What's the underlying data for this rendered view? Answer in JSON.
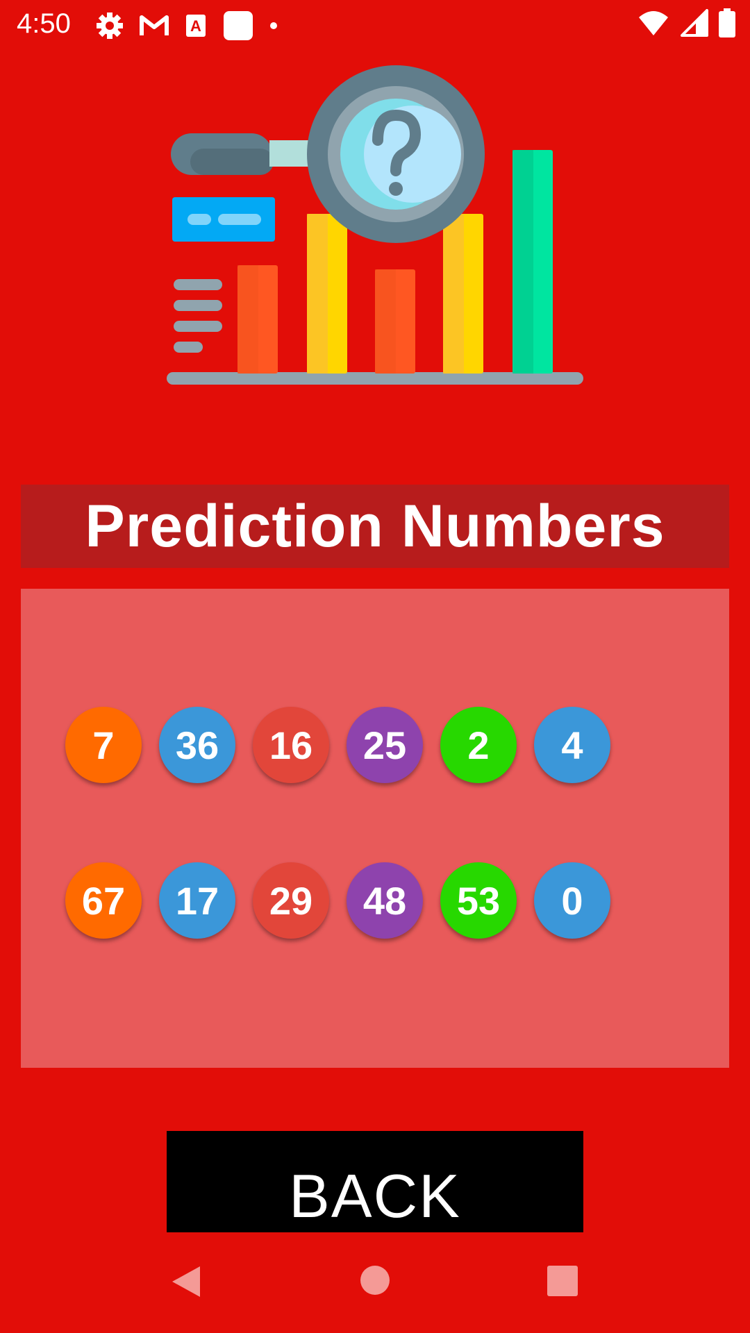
{
  "status_bar": {
    "time": "4:50",
    "icons": [
      "settings-icon",
      "gmail-icon",
      "text-app-icon",
      "app-square-icon",
      "notification-dot-icon"
    ],
    "right_icons": [
      "wifi-icon",
      "signal-icon",
      "battery-icon"
    ]
  },
  "header": {
    "illustration": "magnifying-glass-bar-chart-icon",
    "title": "Prediction Numbers"
  },
  "predictions": {
    "row1": [
      {
        "value": "7",
        "color": "#ff6a00"
      },
      {
        "value": "36",
        "color": "#3b97d9"
      },
      {
        "value": "16",
        "color": "#e2463a"
      },
      {
        "value": "25",
        "color": "#8e43ad"
      },
      {
        "value": "2",
        "color": "#27d800"
      },
      {
        "value": "4",
        "color": "#3b97d9"
      }
    ],
    "row2": [
      {
        "value": "67",
        "color": "#ff6a00"
      },
      {
        "value": "17",
        "color": "#3b97d9"
      },
      {
        "value": "29",
        "color": "#e2463a"
      },
      {
        "value": "48",
        "color": "#8e43ad"
      },
      {
        "value": "53",
        "color": "#27d800"
      },
      {
        "value": "0",
        "color": "#3b97d9"
      }
    ]
  },
  "actions": {
    "back_label": "BACK"
  },
  "nav_bar": {
    "items": [
      "back-nav-icon",
      "home-nav-icon",
      "recents-nav-icon"
    ]
  },
  "colors": {
    "background": "#e20d08",
    "title_bar": "#b71c1c",
    "panel": "#e85a5a",
    "button": "#000000"
  }
}
